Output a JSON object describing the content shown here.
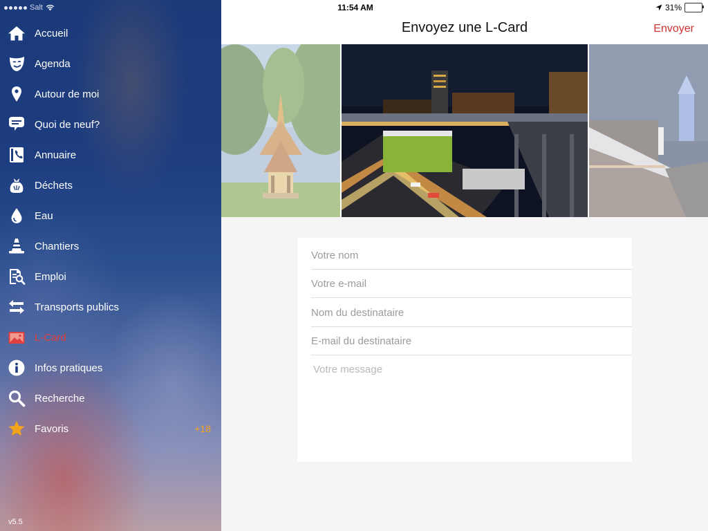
{
  "status": {
    "carrier": "Salt",
    "time": "11:54 AM",
    "battery": "31%",
    "battery_level": 0.31
  },
  "sidebar": {
    "items": [
      {
        "label": "Accueil",
        "icon": "home-icon"
      },
      {
        "label": "Agenda",
        "icon": "theater-mask-icon"
      },
      {
        "label": "Autour de moi",
        "icon": "location-pin-icon"
      },
      {
        "label": "Quoi de neuf?",
        "icon": "chat-bubble-icon"
      },
      {
        "label": "Annuaire",
        "icon": "phone-book-icon"
      },
      {
        "label": "Déchets",
        "icon": "trash-bag-icon"
      },
      {
        "label": "Eau",
        "icon": "water-drop-icon"
      },
      {
        "label": "Chantiers",
        "icon": "traffic-cone-icon"
      },
      {
        "label": "Emploi",
        "icon": "job-document-icon"
      },
      {
        "label": "Transports publics",
        "icon": "transport-arrows-icon"
      },
      {
        "label": "L-Card",
        "icon": "postcard-icon",
        "active": true
      },
      {
        "label": "Infos pratiques",
        "icon": "info-icon"
      },
      {
        "label": "Recherche",
        "icon": "search-icon"
      },
      {
        "label": "Favoris",
        "icon": "star-icon",
        "badge": "+18"
      }
    ],
    "version": "v5.5",
    "active_color": "#e0403f",
    "badge_color": "#f0a31b"
  },
  "header": {
    "title": "Envoyez une L-Card",
    "action_label": "Envoyer",
    "action_color": "#d0312f"
  },
  "form": {
    "name_placeholder": "Votre nom",
    "email_placeholder": "Votre e-mail",
    "recipient_name_placeholder": "Nom du destinataire",
    "recipient_email_placeholder": "E-mail du destinataire",
    "message_placeholder": "Votre message"
  }
}
